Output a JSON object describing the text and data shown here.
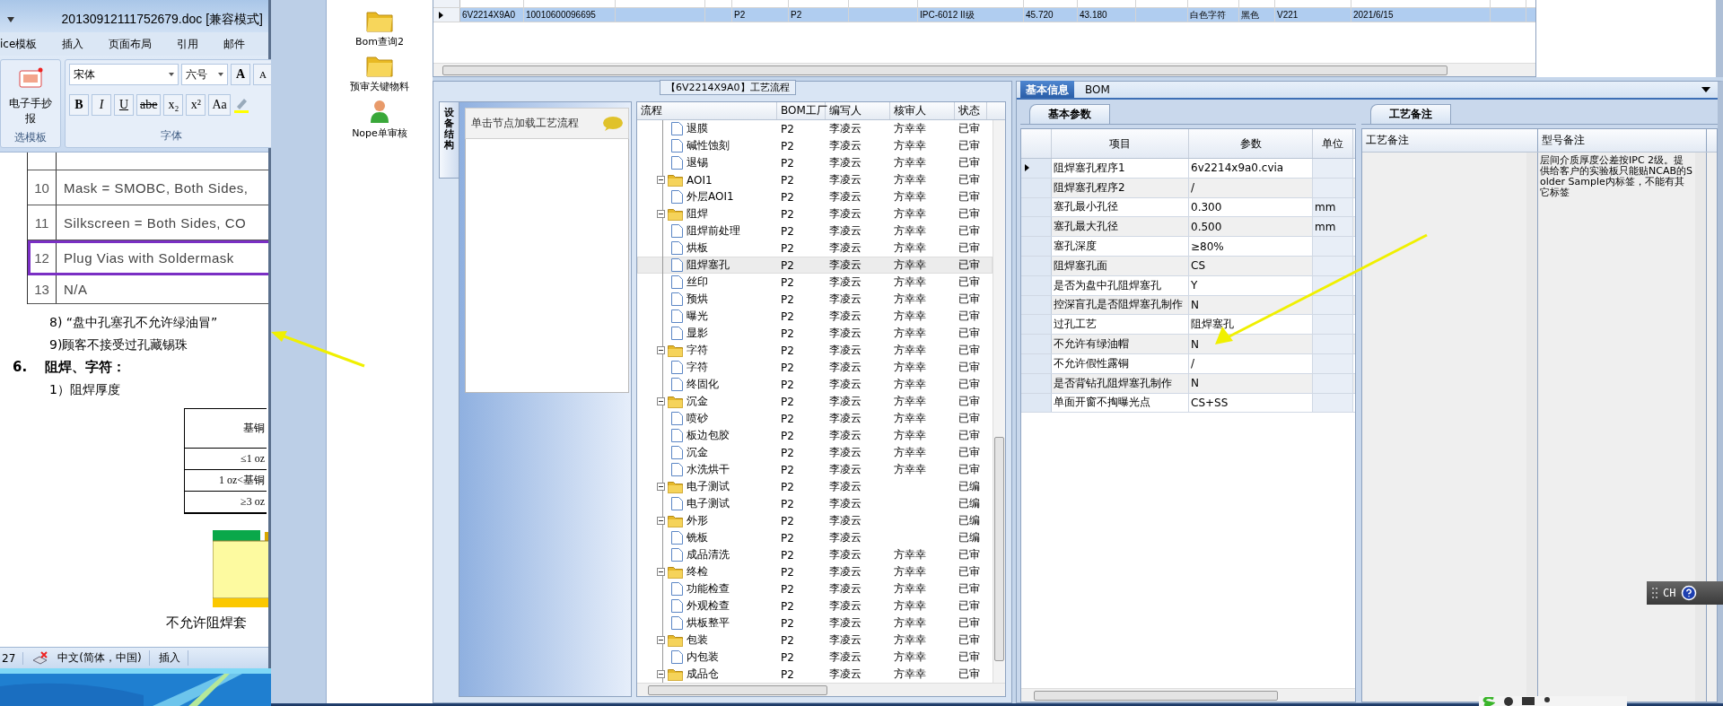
{
  "word": {
    "title": "20130912111752679.doc [兼容模式]",
    "ribbon_tabs": [
      "ice模板",
      "插入",
      "页面布局",
      "引用",
      "邮件"
    ],
    "ribbon": {
      "template_button": "电子手抄报",
      "template_group": "选模板",
      "font_name": "宋体",
      "font_size": "六号",
      "grow_font": "A",
      "shrink_font": "A",
      "font_group": "字体",
      "format_buttons": [
        {
          "label": "B",
          "kind": "bold"
        },
        {
          "label": "I",
          "kind": "italic"
        },
        {
          "label": "U",
          "kind": "underline"
        },
        {
          "label": "abe",
          "kind": "strike"
        },
        {
          "label": "x₂",
          "kind": "plain"
        },
        {
          "label": "x²",
          "kind": "plain"
        },
        {
          "label": "Aa",
          "kind": "plain"
        }
      ]
    },
    "spec_table": [
      {
        "no": "10",
        "text": "Mask = SMOBC, Both Sides,",
        "highlighted": false
      },
      {
        "no": "11",
        "text": "Silkscreen = Both Sides, CO",
        "highlighted": false
      },
      {
        "no": "12",
        "text": "Plug Vias with Soldermask",
        "highlighted": true
      },
      {
        "no": "13",
        "text": "N/A",
        "highlighted": false
      }
    ],
    "paragraphs": [
      {
        "kind": "item",
        "text": "8) “盘中孔塞孔不允许绿油冒”"
      },
      {
        "kind": "item",
        "text": "9)顾客不接受过孔藏锡珠"
      },
      {
        "kind": "heading",
        "number": "6.",
        "text": "阻焊、字符："
      },
      {
        "kind": "item",
        "text": "1）阻焊厚度"
      }
    ],
    "thickness_table": [
      "基铜",
      "≤1 oz",
      "1 oz<基铜",
      "≥3 oz"
    ],
    "caption": "不允许阻焊套",
    "status_bar": [
      "27",
      "中文(简体，中国)",
      "插入"
    ]
  },
  "sidebar": {
    "items": [
      {
        "label": "Bom查询2",
        "kind": "folder"
      },
      {
        "label": "预审关键物料",
        "kind": "folder"
      },
      {
        "label": "Nope单审核",
        "kind": "user"
      }
    ]
  },
  "order_grid": {
    "rows": [
      {
        "selected": true,
        "column_1": "6V2214X9A0",
        "column_2": "10010600096695",
        "column_5": "P2",
        "column_6": "P2",
        "column_8": "IPC-6012 II级",
        "column_9": "45.720",
        "column_10": "43.180",
        "column_12": "白色字符",
        "column_13": "黑色",
        "column_14": "V221",
        "column_15": "2021/6/15"
      }
    ]
  },
  "process_panel": {
    "title": "【6V2214X9A0】工艺流程",
    "side_tab": "设备结构",
    "hint": "单击节点加载工艺流程",
    "columns": [
      "流程",
      "BOM工厂",
      "编写人",
      "核审人",
      "状态"
    ],
    "rows": [
      {
        "kind": "leaf",
        "name": "退膜",
        "factory": "P2",
        "writer": "李凌云",
        "checker": "方幸幸",
        "status": "已审",
        "selected": false
      },
      {
        "kind": "leaf",
        "name": "碱性蚀刻",
        "factory": "P2",
        "writer": "李凌云",
        "checker": "方幸幸",
        "status": "已审",
        "selected": false
      },
      {
        "kind": "leaf",
        "name": "退锡",
        "factory": "P2",
        "writer": "李凌云",
        "checker": "方幸幸",
        "status": "已审",
        "selected": false
      },
      {
        "kind": "folder",
        "name": "AOI1",
        "factory": "P2",
        "writer": "李凌云",
        "checker": "方幸幸",
        "status": "已审",
        "selected": false,
        "expanded": true,
        "children": [
          {
            "kind": "leaf",
            "name": "外层AOI1",
            "factory": "P2",
            "writer": "李凌云",
            "checker": "方幸幸",
            "status": "已审",
            "selected": false
          }
        ]
      },
      {
        "kind": "folder",
        "name": "阻焊",
        "factory": "P2",
        "writer": "李凌云",
        "checker": "方幸幸",
        "status": "已审",
        "selected": false,
        "expanded": true,
        "children": [
          {
            "kind": "leaf",
            "name": "阻焊前处理",
            "factory": "P2",
            "writer": "李凌云",
            "checker": "方幸幸",
            "status": "已审",
            "selected": false
          },
          {
            "kind": "leaf",
            "name": "烘板",
            "factory": "P2",
            "writer": "李凌云",
            "checker": "方幸幸",
            "status": "已审",
            "selected": false
          },
          {
            "kind": "leaf",
            "name": "阻焊塞孔",
            "factory": "P2",
            "writer": "李凌云",
            "checker": "方幸幸",
            "status": "已审",
            "selected": true
          },
          {
            "kind": "leaf",
            "name": "丝印",
            "factory": "P2",
            "writer": "李凌云",
            "checker": "方幸幸",
            "status": "已审",
            "selected": false
          },
          {
            "kind": "leaf",
            "name": "预烘",
            "factory": "P2",
            "writer": "李凌云",
            "checker": "方幸幸",
            "status": "已审",
            "selected": false
          },
          {
            "kind": "leaf",
            "name": "曝光",
            "factory": "P2",
            "writer": "李凌云",
            "checker": "方幸幸",
            "status": "已审",
            "selected": false
          },
          {
            "kind": "leaf",
            "name": "显影",
            "factory": "P2",
            "writer": "李凌云",
            "checker": "方幸幸",
            "status": "已审",
            "selected": false
          }
        ]
      },
      {
        "kind": "folder",
        "name": "字符",
        "factory": "P2",
        "writer": "李凌云",
        "checker": "方幸幸",
        "status": "已审",
        "selected": false,
        "expanded": true,
        "children": [
          {
            "kind": "leaf",
            "name": "字符",
            "factory": "P2",
            "writer": "李凌云",
            "checker": "方幸幸",
            "status": "已审",
            "selected": false
          },
          {
            "kind": "leaf",
            "name": "终固化",
            "factory": "P2",
            "writer": "李凌云",
            "checker": "方幸幸",
            "status": "已审",
            "selected": false
          }
        ]
      },
      {
        "kind": "folder",
        "name": "沉金",
        "factory": "P2",
        "writer": "李凌云",
        "checker": "方幸幸",
        "status": "已审",
        "selected": false,
        "expanded": true,
        "children": [
          {
            "kind": "leaf",
            "name": "喷砂",
            "factory": "P2",
            "writer": "李凌云",
            "checker": "方幸幸",
            "status": "已审",
            "selected": false
          },
          {
            "kind": "leaf",
            "name": "板边包胶",
            "factory": "P2",
            "writer": "李凌云",
            "checker": "方幸幸",
            "status": "已审",
            "selected": false
          },
          {
            "kind": "leaf",
            "name": "沉金",
            "factory": "P2",
            "writer": "李凌云",
            "checker": "方幸幸",
            "status": "已审",
            "selected": false
          },
          {
            "kind": "leaf",
            "name": "水洗烘干",
            "factory": "P2",
            "writer": "李凌云",
            "checker": "方幸幸",
            "status": "已审",
            "selected": false
          }
        ]
      },
      {
        "kind": "folder",
        "name": "电子测试",
        "factory": "P2",
        "writer": "李凌云",
        "status": "已编",
        "selected": false,
        "expanded": true,
        "children": [
          {
            "kind": "leaf",
            "name": "电子测试",
            "factory": "P2",
            "writer": "李凌云",
            "status": "已编",
            "selected": false
          }
        ]
      },
      {
        "kind": "folder",
        "name": "外形",
        "factory": "P2",
        "writer": "李凌云",
        "status": "已编",
        "selected": false,
        "expanded": true,
        "children": [
          {
            "kind": "leaf",
            "name": "铣板",
            "factory": "P2",
            "writer": "李凌云",
            "status": "已编",
            "selected": false
          },
          {
            "kind": "leaf",
            "name": "成品清洗",
            "factory": "P2",
            "writer": "李凌云",
            "checker": "方幸幸",
            "status": "已审",
            "selected": false
          }
        ]
      },
      {
        "kind": "folder",
        "name": "终检",
        "factory": "P2",
        "writer": "李凌云",
        "checker": "方幸幸",
        "status": "已审",
        "selected": false,
        "expanded": true,
        "children": [
          {
            "kind": "leaf",
            "name": "功能检查",
            "factory": "P2",
            "writer": "李凌云",
            "checker": "方幸幸",
            "status": "已审",
            "selected": false
          },
          {
            "kind": "leaf",
            "name": "外观检查",
            "factory": "P2",
            "writer": "李凌云",
            "checker": "方幸幸",
            "status": "已审",
            "selected": false
          },
          {
            "kind": "leaf",
            "name": "烘板整平",
            "factory": "P2",
            "writer": "李凌云",
            "checker": "方幸幸",
            "status": "已审",
            "selected": false
          }
        ]
      },
      {
        "kind": "folder",
        "name": "包装",
        "factory": "P2",
        "writer": "李凌云",
        "checker": "方幸幸",
        "status": "已审",
        "selected": false,
        "expanded": true,
        "children": [
          {
            "kind": "leaf",
            "name": "内包装",
            "factory": "P2",
            "writer": "李凌云",
            "checker": "方幸幸",
            "status": "已审",
            "selected": false
          }
        ]
      },
      {
        "kind": "folder",
        "name": "成品仓",
        "factory": "P2",
        "writer": "李凌云",
        "checker": "方幸幸",
        "status": "已审",
        "selected": false,
        "expanded": true
      }
    ]
  },
  "info_panel": {
    "tabs": [
      {
        "label": "基本信息",
        "selected": true
      },
      {
        "label": "BOM",
        "selected": false
      }
    ],
    "params": {
      "tab": "基本参数",
      "columns": [
        "项目",
        "参数",
        "单位"
      ],
      "rows": [
        {
          "item": "阻焊塞孔程序1",
          "value": "6v2214x9a0.cvia",
          "current": true
        },
        {
          "item": "阻焊塞孔程序2",
          "value": "/",
          "current": false
        },
        {
          "item": "塞孔最小孔径",
          "value": "0.300",
          "unit": "mm",
          "current": false
        },
        {
          "item": "塞孔最大孔径",
          "value": "0.500",
          "unit": "mm",
          "current": false
        },
        {
          "item": "塞孔深度",
          "value": "≥80%",
          "current": false
        },
        {
          "item": "阻焊塞孔面",
          "value": "CS",
          "current": false
        },
        {
          "item": "是否为盘中孔阻焊塞孔",
          "value": "Y",
          "current": false
        },
        {
          "item": "控深盲孔是否阻焊塞孔制作",
          "value": "N",
          "current": false
        },
        {
          "item": "过孔工艺",
          "value": "阻焊塞孔",
          "current": false
        },
        {
          "item": "不允许有绿油帽",
          "value": "N",
          "current": false
        },
        {
          "item": "不允许假性露铜",
          "value": "/",
          "current": false
        },
        {
          "item": "是否背钻孔阻焊塞孔制作",
          "value": "N",
          "current": false
        },
        {
          "item": "单面开窗不掏曝光点",
          "value": "CS+SS",
          "current": false
        }
      ]
    },
    "notes": {
      "tab": "工艺备注",
      "columns": [
        "工艺备注",
        "型号备注"
      ],
      "model_note": "层间介质厚度公差按IPC 2级。提供给客户的实验板只能贴NCAB的Solder Sample内标签，不能有其它标签"
    }
  },
  "language_bar": {
    "language": "CH"
  }
}
